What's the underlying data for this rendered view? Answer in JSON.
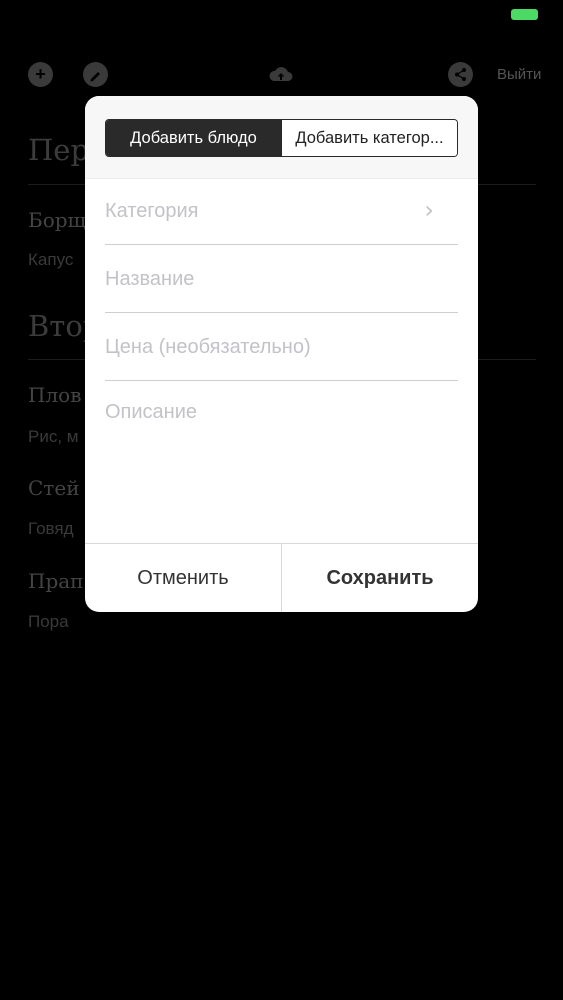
{
  "status_bar": {
    "battery_color": "#4cd964"
  },
  "toolbar": {
    "icons": [
      "plus-icon",
      "pencil-icon",
      "cloud-upload-icon",
      "share-icon"
    ],
    "logout_label": "Выйти"
  },
  "background_menu": {
    "sections": [
      {
        "title": "Пер"
      },
      {
        "title": "Втор"
      }
    ],
    "items": [
      {
        "name": "Борщ",
        "desc": "Капус"
      },
      {
        "name": "Плов",
        "desc": "Рис, м"
      },
      {
        "name": "Стей",
        "desc": "Говяд"
      },
      {
        "name": "Прап",
        "desc": "Пора"
      }
    ]
  },
  "modal": {
    "tabs": {
      "add_dish": "Добавить блюдо",
      "add_category": "Добавить категор..."
    },
    "fields": {
      "category_placeholder": "Категория",
      "name_placeholder": "Название",
      "price_placeholder": "Цена (необязательно)",
      "description_placeholder": "Описание"
    },
    "buttons": {
      "cancel": "Отменить",
      "save": "Сохранить"
    }
  }
}
